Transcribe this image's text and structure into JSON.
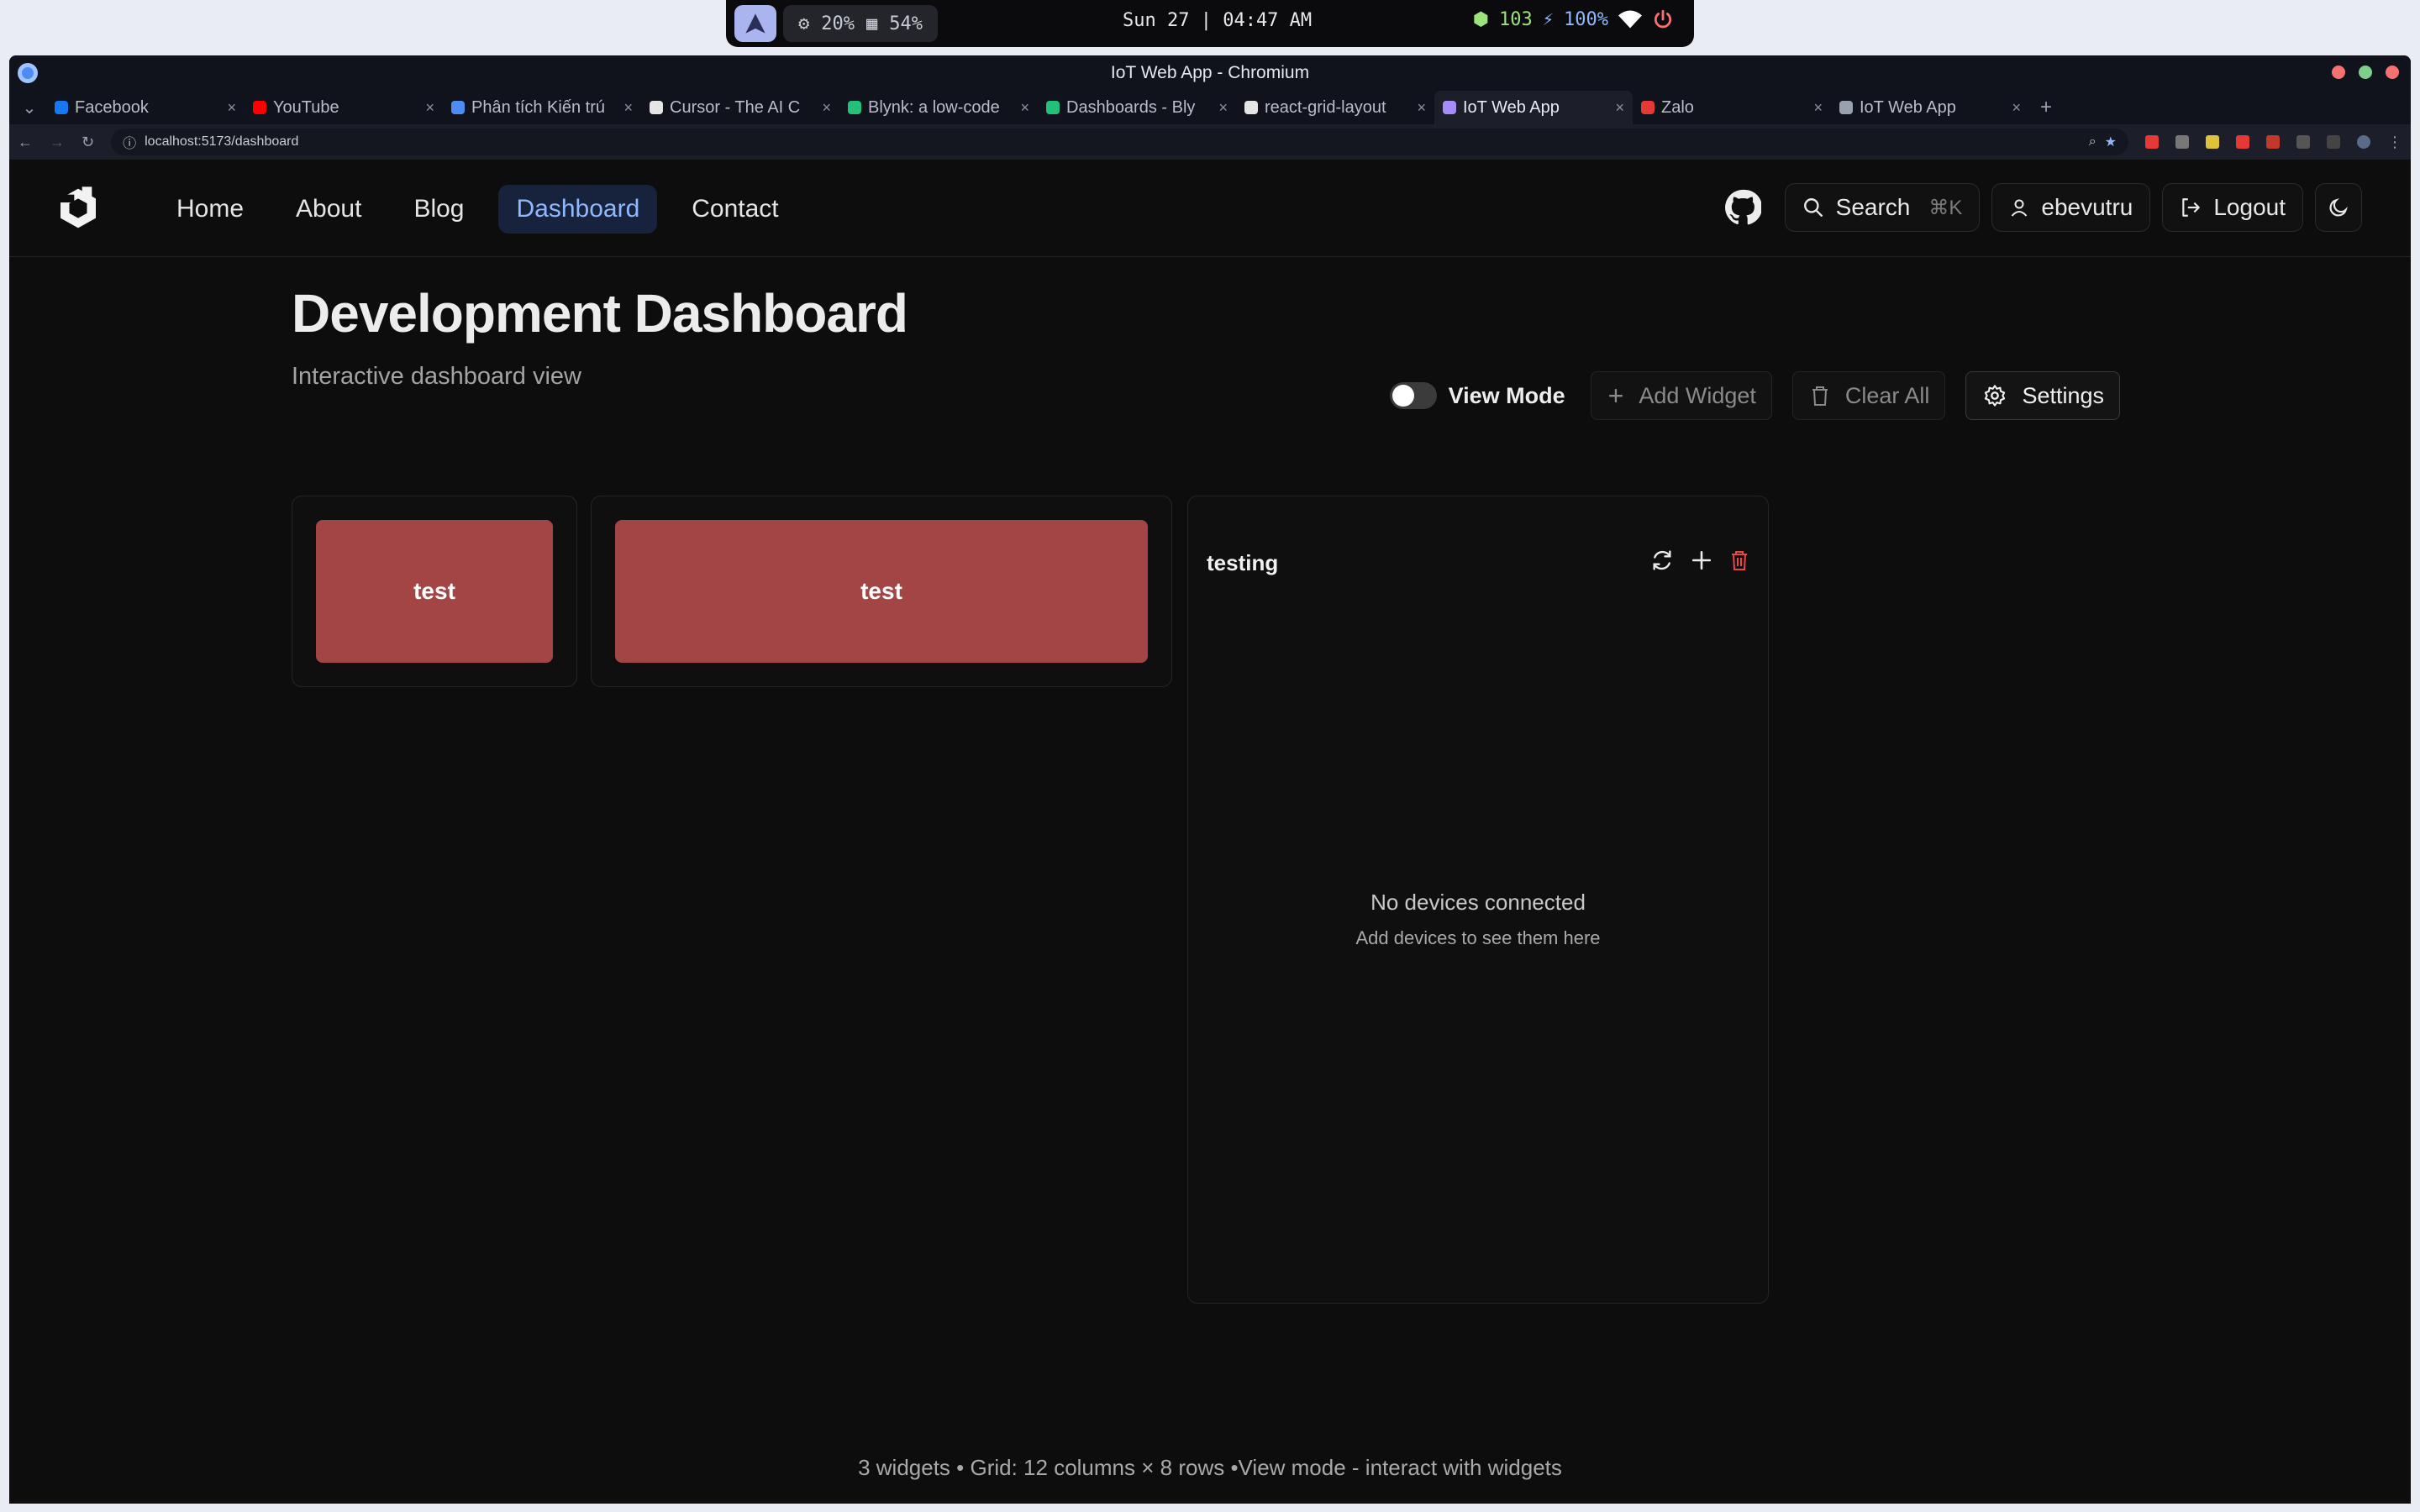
{
  "system_bar": {
    "cpu": "20%",
    "ram": "54%",
    "clock": "Sun 27 | 04:47 AM",
    "updates": "103",
    "battery": "100%"
  },
  "window": {
    "title": "IoT Web App - Chromium"
  },
  "tabs": [
    {
      "label": "Facebook",
      "favicon_color": "#1877f2",
      "active": false
    },
    {
      "label": "YouTube",
      "favicon_color": "#ff0000",
      "active": false
    },
    {
      "label": "Phân tích Kiến trú",
      "favicon_color": "#4d8cf5",
      "active": false
    },
    {
      "label": "Cursor - The AI C",
      "favicon_color": "#e5e5e5",
      "active": false
    },
    {
      "label": "Blynk: a low-code",
      "favicon_color": "#22c07a",
      "active": false
    },
    {
      "label": "Dashboards - Bly",
      "favicon_color": "#22c07a",
      "active": false
    },
    {
      "label": "react-grid-layout",
      "favicon_color": "#e5e5e5",
      "active": false
    },
    {
      "label": "IoT Web App",
      "favicon_color": "#a78bfa",
      "active": true
    },
    {
      "label": "Zalo",
      "favicon_color": "#e53935",
      "active": false
    },
    {
      "label": "IoT Web App",
      "favicon_color": "#9aa0ad",
      "active": false
    }
  ],
  "address_bar": {
    "url": "localhost:5173/dashboard"
  },
  "nav": {
    "links": [
      "Home",
      "About",
      "Blog",
      "Dashboard",
      "Contact"
    ],
    "active_link": "Dashboard",
    "search_label": "Search",
    "search_shortcut": "⌘K",
    "username": "ebevutru",
    "logout_label": "Logout"
  },
  "header": {
    "title": "Development Dashboard",
    "subtitle": "Interactive dashboard view"
  },
  "toolbar": {
    "view_mode_label": "View Mode",
    "view_mode_on": false,
    "add_widget_label": "Add Widget",
    "clear_all_label": "Clear All",
    "settings_label": "Settings"
  },
  "widgets": [
    {
      "type": "button",
      "label": "test",
      "color": "#a34545"
    },
    {
      "type": "button",
      "label": "test",
      "color": "#a34545"
    },
    {
      "type": "device-list",
      "title": "testing",
      "empty_title": "No devices connected",
      "empty_subtitle": "Add devices to see them here"
    }
  ],
  "status_line": "3 widgets • Grid: 12 columns × 8 rows •View mode - interact with widgets",
  "colors": {
    "accent": "#8fb8ff",
    "nav_active_bg": "#17233c",
    "widget_button": "#a34545",
    "danger_icon": "#ef4444"
  }
}
